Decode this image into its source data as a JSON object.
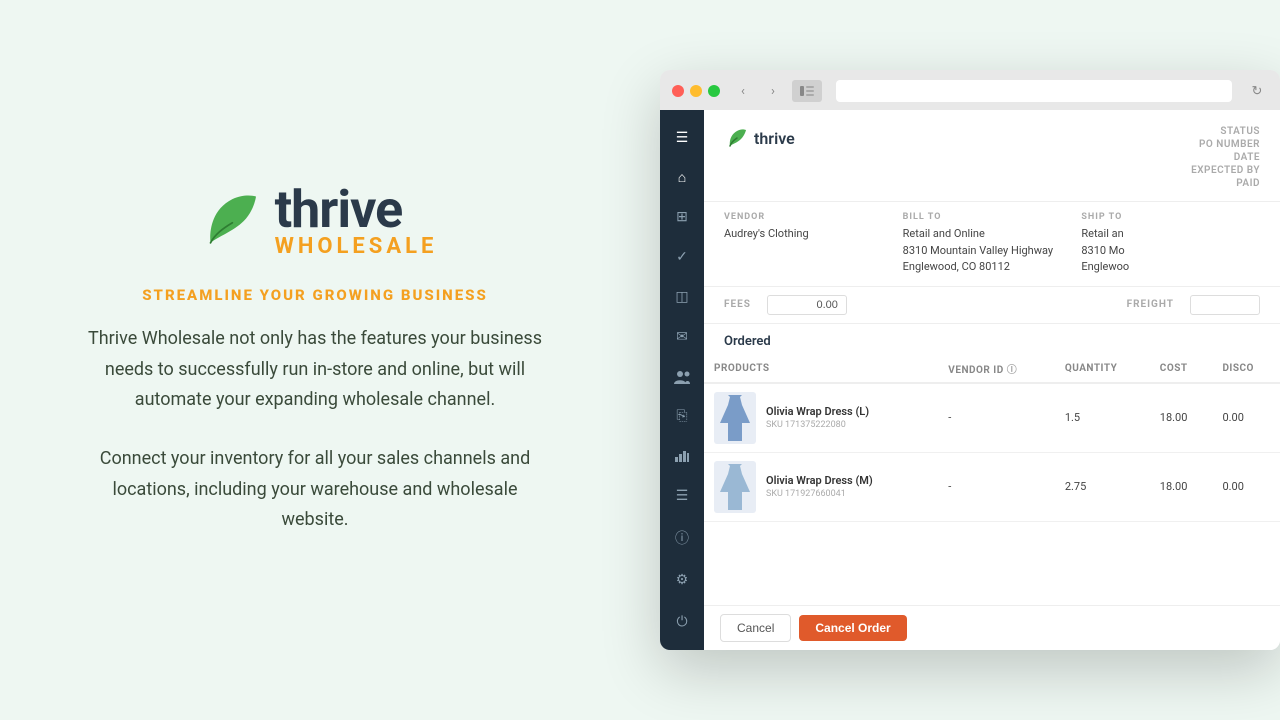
{
  "left": {
    "logo_thrive": "thrive",
    "logo_wholesale": "WHOLESALE",
    "tagline": "STREAMLINE YOUR GROWING BUSINESS",
    "description1": "Thrive Wholesale not only has the features your business needs to successfully run in-store and online, but will automate your expanding wholesale channel.",
    "description2": "Connect your inventory for all your sales channels and locations, including your warehouse and wholesale website."
  },
  "browser": {
    "address_bar_placeholder": ""
  },
  "app": {
    "thrive_logo_text": "thrive",
    "po_meta": {
      "status_label": "STATUS",
      "po_number_label": "PO NUMBER",
      "date_label": "DATE",
      "expected_by_label": "EXPECTED BY",
      "paid_label": "PAID"
    },
    "vendor": {
      "label": "VENDOR",
      "name": "Audrey's Clothing"
    },
    "bill_to": {
      "label": "BILL TO",
      "name": "Retail and Online",
      "address": "8310 Mountain Valley Highway",
      "city_state": "Englewood, CO 80112"
    },
    "ship_to": {
      "label": "SHIP TO",
      "name": "Retail an",
      "address": "8310 Mo",
      "city_state": "Englewoo"
    },
    "fees": {
      "label": "FEES",
      "value": "0.00",
      "freight_label": "FREIGHT"
    },
    "ordered": {
      "title": "Ordered",
      "columns": [
        "Products",
        "Vendor ID",
        "Quantity",
        "Cost",
        "Disco"
      ],
      "rows": [
        {
          "name": "Olivia Wrap Dress (L)",
          "sku": "SKU 171375222080",
          "vendor_id": "-",
          "quantity": "1.5",
          "cost": "18.00",
          "discount": "0.00"
        },
        {
          "name": "Olivia Wrap Dress (M)",
          "sku": "SKU 171927660041",
          "vendor_id": "-",
          "quantity": "2.75",
          "cost": "18.00",
          "discount": "0.00"
        }
      ]
    },
    "footer": {
      "cancel_label": "Cancel",
      "cancel_order_label": "Cancel Order"
    }
  },
  "sidebar": {
    "icons": [
      {
        "name": "menu-icon",
        "symbol": "☰"
      },
      {
        "name": "home-icon",
        "symbol": "⌂"
      },
      {
        "name": "grid-icon",
        "symbol": "⊞"
      },
      {
        "name": "check-icon",
        "symbol": "✓"
      },
      {
        "name": "document-icon",
        "symbol": "◫"
      },
      {
        "name": "mail-icon",
        "symbol": "✉"
      },
      {
        "name": "people-icon",
        "symbol": "👥"
      },
      {
        "name": "copy-icon",
        "symbol": "⎘"
      },
      {
        "name": "chart-icon",
        "symbol": "▦"
      }
    ],
    "bottom_icons": [
      {
        "name": "list-bottom-icon",
        "symbol": "☰"
      },
      {
        "name": "info-icon",
        "symbol": "ⓘ"
      },
      {
        "name": "settings-icon",
        "symbol": "⚙"
      },
      {
        "name": "power-icon",
        "symbol": "⏻"
      }
    ]
  }
}
